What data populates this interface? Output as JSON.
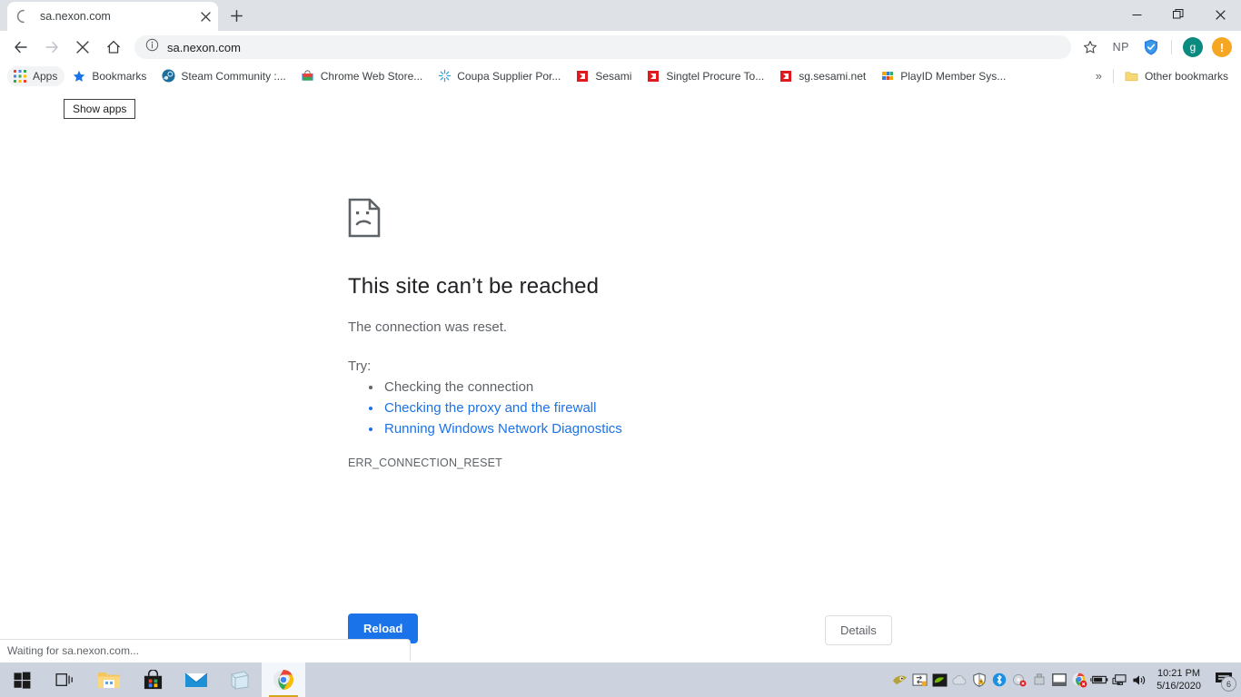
{
  "window": {
    "minimize_label": "Minimize",
    "restore_label": "Restore",
    "close_label": "Close"
  },
  "tab": {
    "title": "sa.nexon.com",
    "close_label": "×",
    "new_tab_label": "+",
    "loading": "loading-spinner"
  },
  "toolbar": {
    "back_label": "Back",
    "forward_label": "Forward",
    "stop_label": "Stop",
    "home_label": "Home",
    "url": "sa.nexon.com",
    "bookmark_label": "Bookmark this tab",
    "extension_np_label": "NP",
    "extension_shield_label": "shield-extension",
    "profile_initial": "g",
    "menu_badge": "!",
    "accent_blue": "#1a73e8",
    "avatar_color": "#0b8a7f",
    "update_color": "#f5a623"
  },
  "bookmarks_bar": {
    "items": [
      {
        "label": "Apps",
        "icon": "apps-grid-icon",
        "hover": true
      },
      {
        "label": "Bookmarks",
        "icon": "star-icon",
        "hover": false
      },
      {
        "label": "Steam Community :...",
        "icon": "steam-icon",
        "hover": false
      },
      {
        "label": "Chrome Web Store...",
        "icon": "chrome-web-store-icon",
        "hover": false
      },
      {
        "label": "Coupa Supplier Por...",
        "icon": "coupa-icon",
        "hover": false
      },
      {
        "label": "Sesami",
        "icon": "sesami-icon",
        "hover": false
      },
      {
        "label": "Singtel Procure To...",
        "icon": "sesami-icon",
        "hover": false
      },
      {
        "label": "sg.sesami.net",
        "icon": "sesami-icon",
        "hover": false
      },
      {
        "label": "PlayID Member Sys...",
        "icon": "playid-icon",
        "hover": false
      }
    ],
    "overflow_label": "»",
    "other_bookmarks_label": "Other bookmarks"
  },
  "tooltip": {
    "text": "Show apps"
  },
  "error_page": {
    "icon": "sad-page-icon",
    "title": "This site can’t be reached",
    "subtitle": "The connection was reset.",
    "try_label": "Try:",
    "suggestions": [
      {
        "text": "Checking the connection",
        "link": false
      },
      {
        "text": "Checking the proxy and the firewall",
        "link": true
      },
      {
        "text": "Running Windows Network Diagnostics",
        "link": true
      }
    ],
    "error_code": "ERR_CONNECTION_RESET",
    "reload_button": "Reload",
    "details_button": "Details"
  },
  "status": {
    "text": "Waiting for sa.nexon.com..."
  },
  "taskbar": {
    "items": [
      {
        "name": "start-button",
        "label": "Start"
      },
      {
        "name": "task-view-button",
        "label": "Task View"
      },
      {
        "name": "file-explorer-button",
        "label": "File Explorer"
      },
      {
        "name": "microsoft-store-button",
        "label": "Microsoft Store"
      },
      {
        "name": "mail-button",
        "label": "Mail"
      },
      {
        "name": "sticky-notes-button",
        "label": "Sticky Notes"
      },
      {
        "name": "chrome-button",
        "label": "Google Chrome"
      }
    ],
    "tray": [
      "nvidia-geforce-icon",
      "display-switch-icon",
      "nvidia-settings-icon",
      "onedrive-icon",
      "security-warning-icon",
      "bluetooth-icon",
      "safely-remove-media-icon",
      "usb-icon",
      "touchpad-icon",
      "chrome-alert-icon",
      "battery-icon",
      "network-icon",
      "volume-icon"
    ],
    "clock_time": "10:21 PM",
    "clock_date": "5/16/2020",
    "notification_count": "6"
  }
}
